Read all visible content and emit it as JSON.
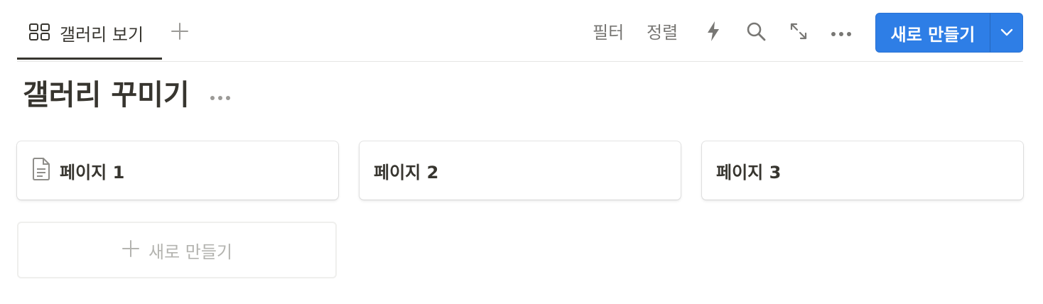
{
  "toolbar": {
    "tab": {
      "icon": "gallery-grid-icon",
      "label": "갤러리 보기"
    },
    "add_view_icon": "plus-icon",
    "filter_label": "필터",
    "sort_label": "정렬",
    "automation_icon": "lightning-icon",
    "search_icon": "search-icon",
    "expand_icon": "expand-arrows-icon",
    "more_icon": "more-horizontal-icon",
    "new_button": {
      "label": "새로 만들기",
      "dropdown_icon": "chevron-down-icon",
      "color": "#2e7ee6"
    }
  },
  "gallery": {
    "title": "갤러리 꾸미기",
    "more_icon": "more-horizontal-icon",
    "cards": [
      {
        "title": "페이지 1",
        "icon": "page-icon"
      },
      {
        "title": "페이지 2"
      },
      {
        "title": "페이지 3"
      }
    ],
    "add_card": {
      "icon": "plus-icon",
      "label": "새로 만들기"
    }
  }
}
